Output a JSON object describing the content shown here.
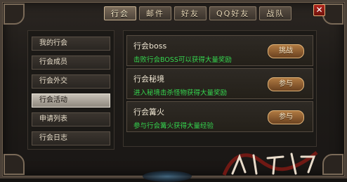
{
  "tabs": [
    {
      "label": "行会",
      "active": true
    },
    {
      "label": "邮件",
      "active": false
    },
    {
      "label": "好友",
      "active": false
    },
    {
      "label": "QQ好友",
      "active": false
    },
    {
      "label": "战队",
      "active": false
    }
  ],
  "close_label": "✕",
  "sidebar": {
    "items": [
      {
        "label": "我的行会",
        "active": false
      },
      {
        "label": "行会成员",
        "active": false
      },
      {
        "label": "行会外交",
        "active": false
      },
      {
        "label": "行会活动",
        "active": true
      },
      {
        "label": "申请列表",
        "active": false
      },
      {
        "label": "行会日志",
        "active": false
      }
    ]
  },
  "activities": [
    {
      "title": "行会boss",
      "desc": "击败行会BOSS可以获得大量奖励",
      "button": "挑战"
    },
    {
      "title": "行会秘境",
      "desc": "进入秘境击杀怪物获得大量奖励",
      "button": "参与"
    },
    {
      "title": "行会篝火",
      "desc": "参与行会篝火获得大量经验",
      "button": "参与"
    }
  ],
  "colors": {
    "accent_green": "#35d64f",
    "close_red": "#b2241c",
    "button_bronze": "#b07a42"
  }
}
